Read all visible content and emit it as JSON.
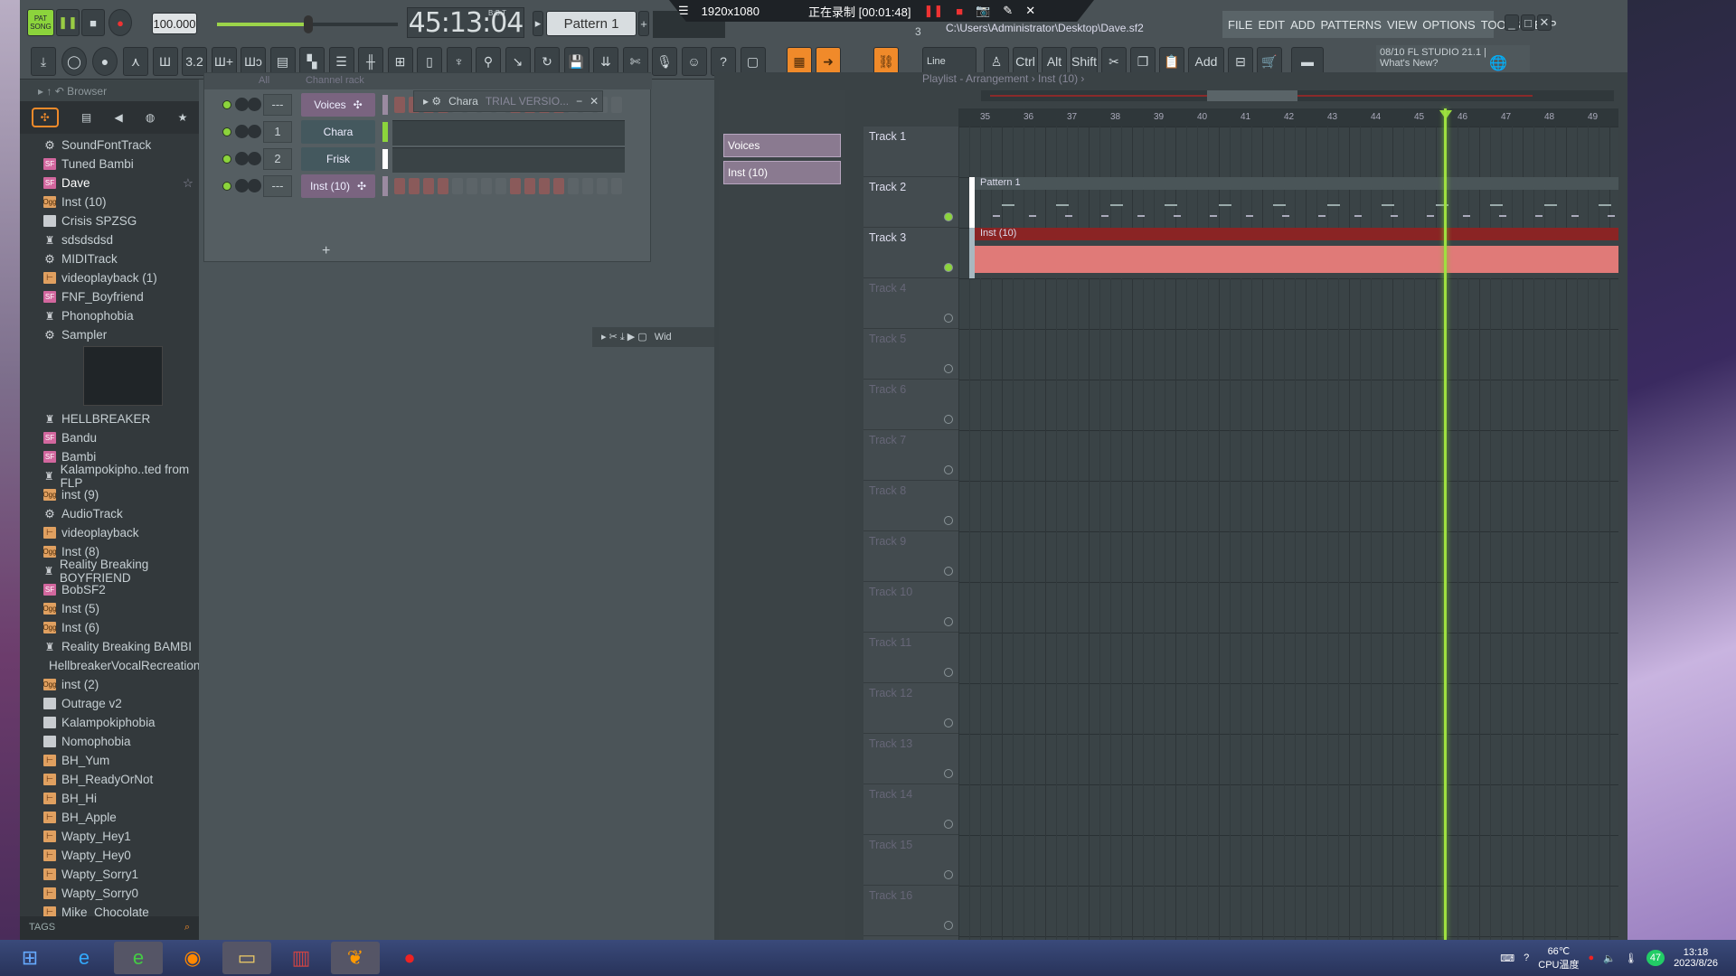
{
  "transport": {
    "mode_pat": "PAT",
    "mode_song": "SONG",
    "tempo": "100.000",
    "time": "45:13:04",
    "time_label": "B:S:T",
    "pattern": "Pattern 1",
    "pattern_num": "3"
  },
  "recorder": {
    "resolution": "1920x1080",
    "status": "正在录制 [00:01:48]"
  },
  "file_path": "C:\\Users\\Administrator\\Desktop\\Dave.sf2",
  "menu": [
    "FILE",
    "EDIT",
    "ADD",
    "PATTERNS",
    "VIEW",
    "OPTIONS",
    "TOOLS",
    "HELP"
  ],
  "toolbar": {
    "snap": "Line",
    "ctrl": "Ctrl",
    "alt": "Alt",
    "shift": "Shift",
    "add": "Add"
  },
  "news": {
    "line1": "08/10  FL STUDIO 21.1 |",
    "line2": "What's New?"
  },
  "browser": {
    "title": "Browser",
    "tags_label": "TAGS",
    "items": [
      {
        "name": "SoundFontTrack",
        "type": "gear"
      },
      {
        "name": "Tuned Bambi",
        "type": "sf"
      },
      {
        "name": "Dave",
        "type": "sf"
      },
      {
        "name": "Inst (10)",
        "type": "ogg"
      },
      {
        "name": "Crisis SPZSG",
        "type": "file"
      },
      {
        "name": "sdsdsdsd",
        "type": "plug"
      },
      {
        "name": "MIDITrack",
        "type": "gear"
      },
      {
        "name": "videoplayback (1)",
        "type": "wav"
      },
      {
        "name": "FNF_Boyfriend",
        "type": "sf"
      },
      {
        "name": "Phonophobia",
        "type": "plug"
      },
      {
        "name": "Sampler",
        "type": "gear"
      },
      {
        "name": "HELLBREAKER",
        "type": "plug"
      },
      {
        "name": "Bandu",
        "type": "sf"
      },
      {
        "name": "Bambi",
        "type": "sf"
      },
      {
        "name": "Kalampokipho..ted from FLP",
        "type": "plug"
      },
      {
        "name": "inst (9)",
        "type": "ogg"
      },
      {
        "name": "AudioTrack",
        "type": "gear"
      },
      {
        "name": "videoplayback",
        "type": "wav"
      },
      {
        "name": "Inst (8)",
        "type": "ogg"
      },
      {
        "name": "Reality Breaking BOYFRIEND",
        "type": "plug"
      },
      {
        "name": "BobSF2",
        "type": "sf"
      },
      {
        "name": "Inst (5)",
        "type": "ogg"
      },
      {
        "name": "Inst (6)",
        "type": "ogg"
      },
      {
        "name": "Reality Breaking BAMBI",
        "type": "plug"
      },
      {
        "name": "HellbreakerVocalRecreation",
        "type": "file"
      },
      {
        "name": "inst (2)",
        "type": "ogg"
      },
      {
        "name": "Outrage v2",
        "type": "file"
      },
      {
        "name": "Kalampokiphobia",
        "type": "file"
      },
      {
        "name": "Nomophobia",
        "type": "file"
      },
      {
        "name": "BH_Yum",
        "type": "wav"
      },
      {
        "name": "BH_ReadyOrNot",
        "type": "wav"
      },
      {
        "name": "BH_Hi",
        "type": "wav"
      },
      {
        "name": "BH_Apple",
        "type": "wav"
      },
      {
        "name": "Wapty_Hey1",
        "type": "wav"
      },
      {
        "name": "Wapty_Hey0",
        "type": "wav"
      },
      {
        "name": "Wapty_Sorry1",
        "type": "wav"
      },
      {
        "name": "Wapty_Sorry0",
        "type": "wav"
      },
      {
        "name": "Mike_Chocolate",
        "type": "wav"
      }
    ]
  },
  "channel_rack": {
    "title": "Channel rack",
    "filter": "All",
    "plugin_window": "Chara",
    "plugin_trial": "TRIAL VERSIO...",
    "channels": [
      {
        "name": "Voices",
        "num": "---",
        "kind": "audio"
      },
      {
        "name": "Chara",
        "num": "1",
        "kind": "plugin"
      },
      {
        "name": "Frisk",
        "num": "2",
        "kind": "plugin"
      },
      {
        "name": "Inst (10)",
        "num": "---",
        "kind": "audio"
      }
    ]
  },
  "mini_toolbar": {
    "label": "Wid"
  },
  "playlist": {
    "title": "Playlist - Arrangement › Inst (10) ›",
    "picker": [
      "Voices",
      "Inst (10)"
    ],
    "ruler": [
      "35",
      "36",
      "37",
      "38",
      "39",
      "40",
      "41",
      "42",
      "43",
      "44",
      "45",
      "46",
      "47",
      "48",
      "49"
    ],
    "playhead_bar": 45.6,
    "tracks": [
      "Track 1",
      "Track 2",
      "Track 3",
      "Track 4",
      "Track 5",
      "Track 6",
      "Track 7",
      "Track 8",
      "Track 9",
      "Track 10",
      "Track 11",
      "Track 12",
      "Track 13",
      "Track 14",
      "Track 15",
      "Track 16"
    ],
    "clips": [
      {
        "track": 2,
        "label": "Pattern 1",
        "color": "#4a5558"
      },
      {
        "track": 3,
        "label": "Inst (10)",
        "color": "#8a2424"
      }
    ]
  },
  "taskbar": {
    "temp": "66℃",
    "temp_label": "CPU温度",
    "badge": "47",
    "time": "13:18",
    "date": "2023/8/26"
  },
  "colors": {
    "accent": "#f08a2a",
    "playhead": "#9fe040",
    "audio_clip": "#e07a78"
  }
}
